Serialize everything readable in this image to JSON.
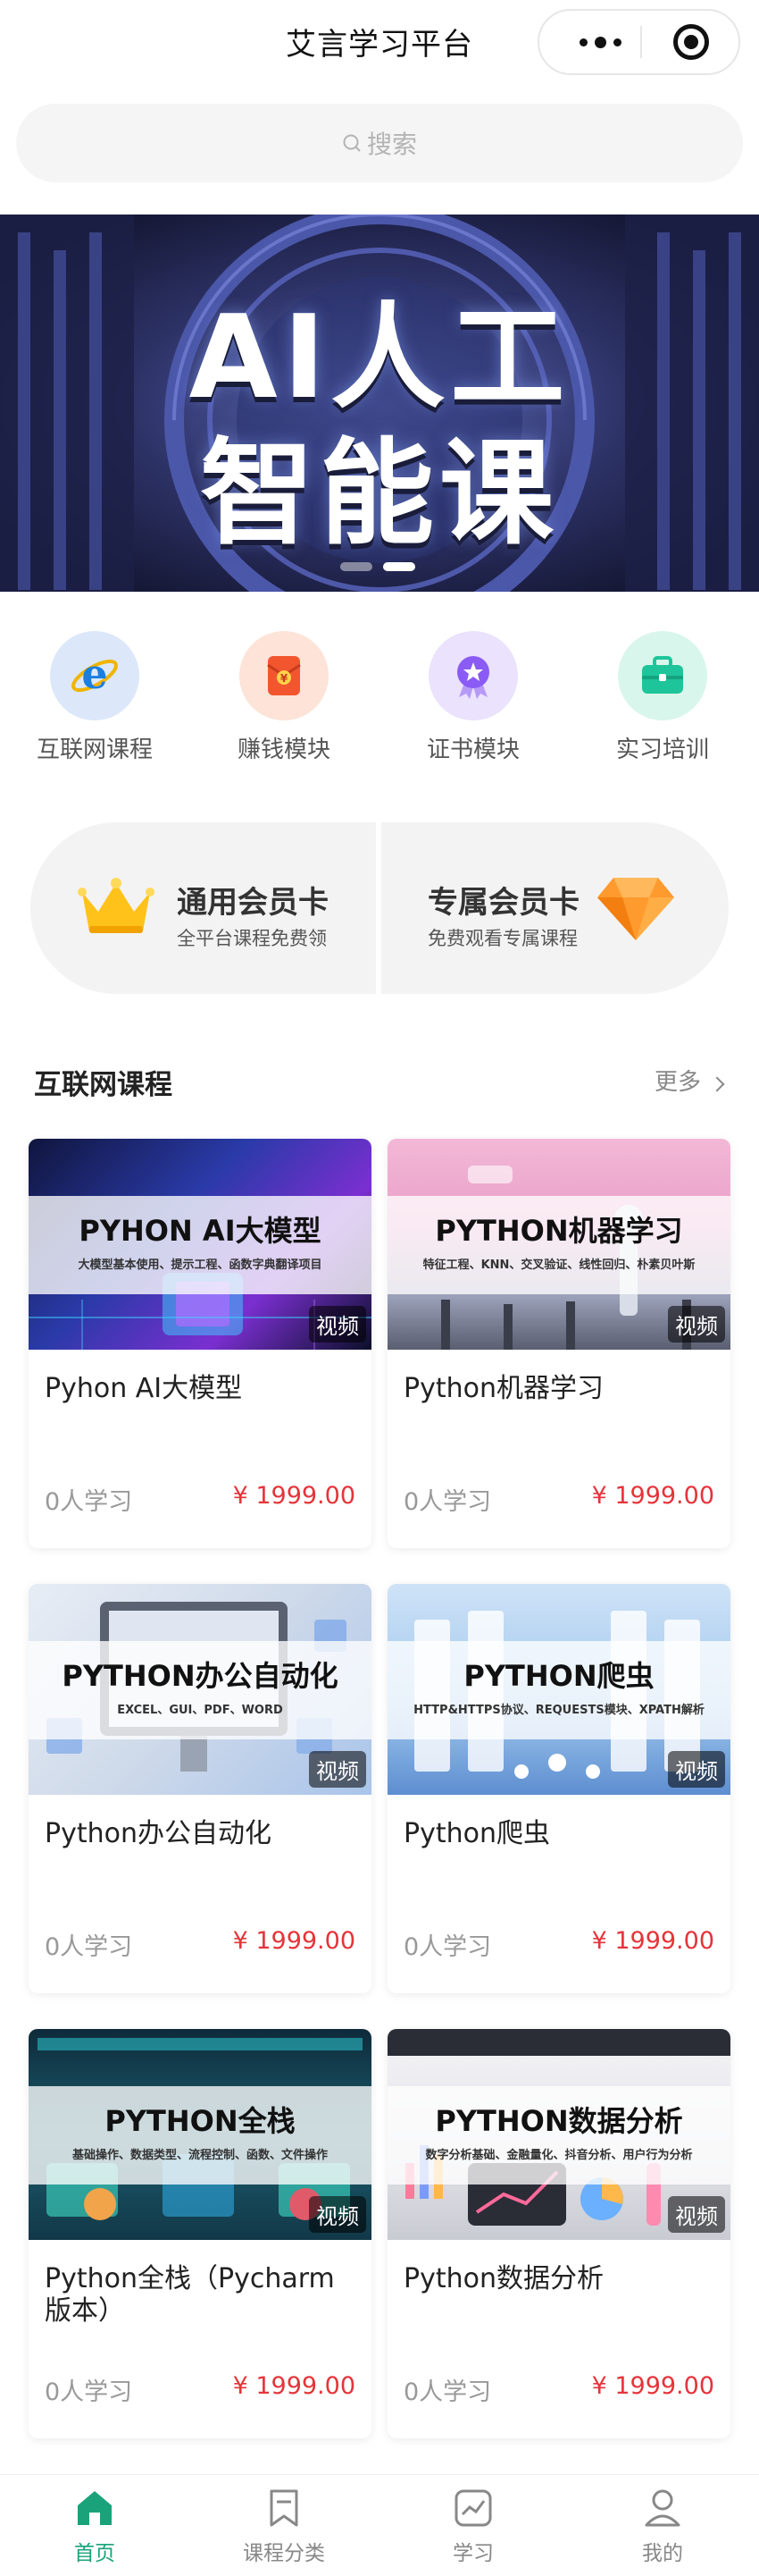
{
  "header": {
    "title": "艾言学习平台"
  },
  "search": {
    "placeholder": "搜索"
  },
  "banner": {
    "line1": "AI人工",
    "line2": "智能课",
    "slides": 2,
    "active_slide": 2
  },
  "categories": [
    {
      "label": "互联网课程",
      "icon": "ie-browser-icon",
      "color": "#1a7fe0"
    },
    {
      "label": "赚钱模块",
      "icon": "red-envelope-icon",
      "color": "#f2562e"
    },
    {
      "label": "证书模块",
      "icon": "medal-icon",
      "color": "#8a5cf5"
    },
    {
      "label": "实习培训",
      "icon": "briefcase-icon",
      "color": "#1fc59a"
    }
  ],
  "members": [
    {
      "title": "通用会员卡",
      "subtitle": "全平台课程免费领",
      "icon": "crown-icon"
    },
    {
      "title": "专属会员卡",
      "subtitle": "免费观看专属课程",
      "icon": "diamond-icon"
    }
  ],
  "section": {
    "title": "互联网课程",
    "more": "更多"
  },
  "courses": [
    {
      "thumb_title": "PYHON AI大模型",
      "thumb_sub": "大模型基本使用、提示工程、函数字典翻译项目",
      "badge": "视频",
      "name": "Pyhon AI大模型",
      "learners": "0人学习",
      "price": "¥ 1999.00"
    },
    {
      "thumb_title": "PYTHON机器学习",
      "thumb_sub": "特征工程、KNN、交叉验证、线性回归、朴素贝叶斯",
      "badge": "视频",
      "name": "Python机器学习",
      "learners": "0人学习",
      "price": "¥ 1999.00"
    },
    {
      "thumb_title": "PYTHON办公自动化",
      "thumb_sub": "EXCEL、GUI、PDF、WORD",
      "badge": "视频",
      "name": "Python办公自动化",
      "learners": "0人学习",
      "price": "¥ 1999.00"
    },
    {
      "thumb_title": "PYTHON爬虫",
      "thumb_sub": "HTTP&HTTPS协议、REQUESTS模块、XPATH解析",
      "badge": "视频",
      "name": "Python爬虫",
      "learners": "0人学习",
      "price": "¥ 1999.00"
    },
    {
      "thumb_title": "PYTHON全栈",
      "thumb_sub": "基础操作、数据类型、流程控制、函数、文件操作",
      "badge": "视频",
      "name": "Python全栈（Pycharm版本）",
      "learners": "0人学习",
      "price": "¥ 1999.00"
    },
    {
      "thumb_title": "PYTHON数据分析",
      "thumb_sub": "数字分析基础、金融量化、抖音分析、用户行为分析",
      "badge": "视频",
      "name": "Python数据分析",
      "learners": "0人学习",
      "price": "¥ 1999.00"
    }
  ],
  "tabbar": [
    {
      "label": "首页",
      "icon": "home-icon",
      "active": true
    },
    {
      "label": "课程分类",
      "icon": "bookmark-icon",
      "active": false
    },
    {
      "label": "学习",
      "icon": "chart-icon",
      "active": false
    },
    {
      "label": "我的",
      "icon": "user-icon",
      "active": false
    }
  ],
  "colors": {
    "accent": "#1aa37a",
    "price": "#e5343a",
    "banner_bg": "#22274f"
  }
}
